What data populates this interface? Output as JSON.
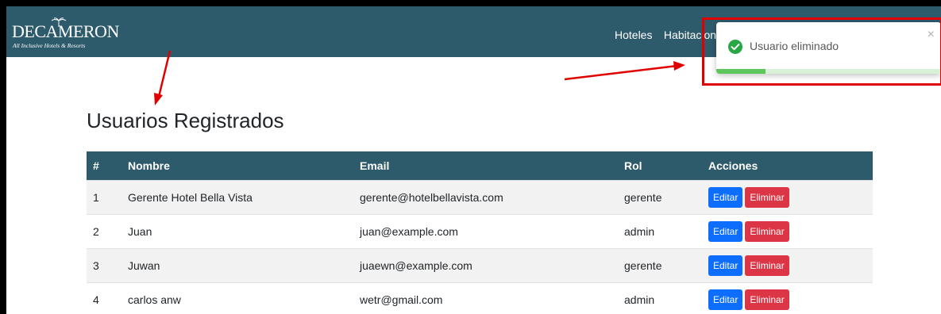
{
  "navbar": {
    "logo": {
      "name": "DECAMERON",
      "tagline": "All Inclusive Hotels & Resorts"
    },
    "links": [
      "Hoteles",
      "Habitacion"
    ]
  },
  "page_title": "Usuarios Registrados",
  "table": {
    "headers": [
      "#",
      "Nombre",
      "Email",
      "Rol",
      "Acciones"
    ],
    "rows": [
      {
        "num": "1",
        "name": "Gerente Hotel Bella Vista",
        "email": "gerente@hotelbellavista.com",
        "role": "gerente"
      },
      {
        "num": "2",
        "name": "Juan",
        "email": "juan@example.com",
        "role": "admin"
      },
      {
        "num": "3",
        "name": "Juwan",
        "email": "juaewn@example.com",
        "role": "gerente"
      },
      {
        "num": "4",
        "name": "carlos anw",
        "email": "wetr@gmail.com",
        "role": "admin"
      }
    ],
    "edit_label": "Editar",
    "delete_label": "Eliminar"
  },
  "toast": {
    "message": "Usuario eliminado",
    "close_symbol": "×",
    "icon": "check-circle-icon",
    "progress": 0.22
  },
  "colors": {
    "navbar": "#2e5b6c",
    "edit_button": "#0d6efd",
    "delete_button": "#dc3545",
    "success": "#28a745",
    "annotation": "#e00000"
  }
}
